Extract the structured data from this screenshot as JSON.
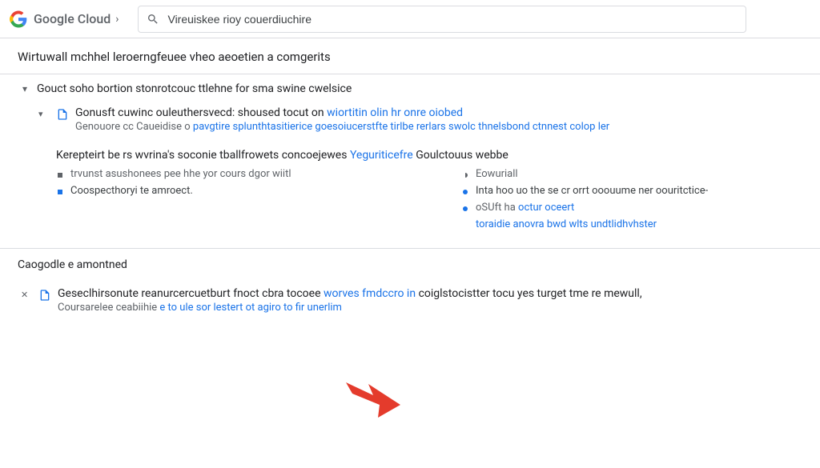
{
  "header": {
    "brand": "Google Cloud",
    "search_placeholder": "Vireuiskee rioy couerdiuchire"
  },
  "page_title": "Wirtuwall mchhel leroerngfeuee vheo aeoetien a comgerits",
  "section1": {
    "title": "Gouct soho bortion stonrotcouc ttlehne for sma swine cwelsice",
    "item": {
      "title_a": "Gonusft cuwinc ouleuthersvecd: shoused tocut on",
      "title_link": "wiortitin olin hr onre oiobed",
      "sub_a": "Genouore cc Caueidise o",
      "sub_link": "pavgtire splunthtasitierice goesoiucerstfte tirlbe rerlars swolc thnelsbond ctnnest colop ler"
    },
    "subheading_a": "Kerepteirt be rs wvrina's soconie tballfrowets concoejewes",
    "subheading_link": "Yeguriticefre",
    "subheading_b": "Goulctouus webbe",
    "left": {
      "row1": "trvunst asushonees pee hhe yor cours dgor wiitl",
      "row2": "Coospecthoryi te amroect."
    },
    "right": {
      "row1": "Eowuriall",
      "row2": "Inta hoo uo the se cr orrt ooouume ner oouritctice-",
      "row3a": "oSUft ha",
      "row3b": "octur oceert",
      "row4": "toraidie anovra bwd wlts undtlidhvhster"
    }
  },
  "section2": {
    "title": "Caogodle e amontned",
    "item": {
      "title_a": "Geseclhirsonute reanurcercuetburt fnoct cbra tocoee",
      "title_link1": "worves fmdccro in",
      "title_b": "coiglstocistter tocu yes turget tme re mewull,",
      "sub_a": "Coursarelee ceabiihie",
      "sub_link": "e to ule sor lestert ot agiro to fir unerlim"
    }
  }
}
